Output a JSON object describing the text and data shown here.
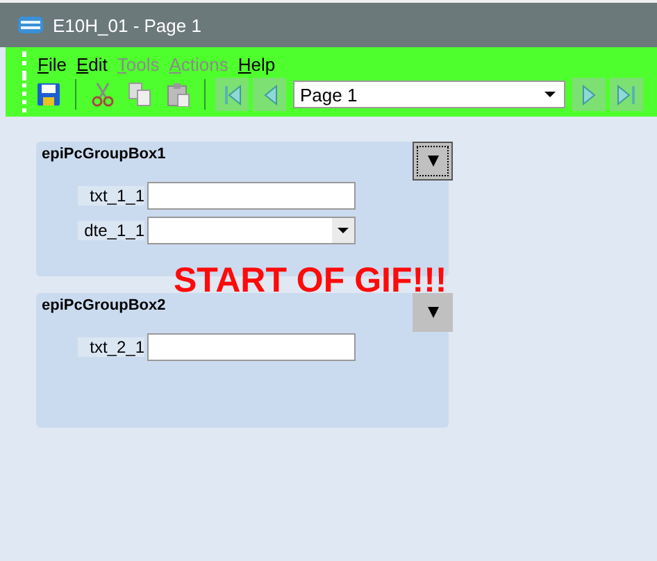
{
  "window": {
    "title": "E10H_01 - Page 1"
  },
  "menu": [
    {
      "label": "File",
      "disabled": false
    },
    {
      "label": "Edit",
      "disabled": false
    },
    {
      "label": "Tools",
      "disabled": true
    },
    {
      "label": "Actions",
      "disabled": true
    },
    {
      "label": "Help",
      "disabled": false
    }
  ],
  "toolbar": [
    {
      "kind": "save"
    },
    {
      "kind": "sep"
    },
    {
      "kind": "cut"
    },
    {
      "kind": "copy"
    },
    {
      "kind": "paste"
    },
    {
      "kind": "sep"
    },
    {
      "kind": "first"
    },
    {
      "kind": "prev"
    },
    {
      "kind": "combo",
      "value": "Page 1"
    },
    {
      "kind": "next"
    },
    {
      "kind": "last"
    }
  ],
  "groups": [
    {
      "title": "epiPcGroupBox1",
      "button_focused": true,
      "fields": [
        {
          "kind": "text",
          "label": "txt_1_1"
        },
        {
          "kind": "date",
          "label": "dte_1_1"
        }
      ]
    },
    {
      "title": "epiPcGroupBox2",
      "button_focused": false,
      "fields": [
        {
          "kind": "text",
          "label": "txt_2_1"
        }
      ]
    }
  ],
  "overlay_text": "START OF GIF!!!"
}
